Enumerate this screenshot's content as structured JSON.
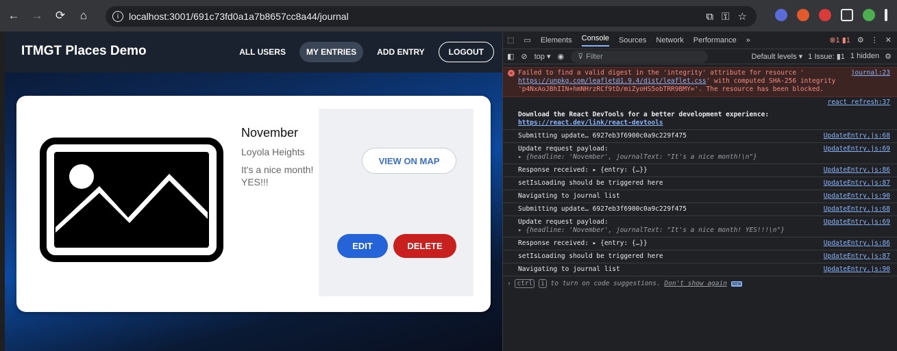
{
  "browser": {
    "url": "localhost:3001/691c73fd0a1a7b8657cc8a44/journal"
  },
  "app": {
    "brand": "ITMGT Places Demo",
    "nav": {
      "all_users": "ALL USERS",
      "my_entries": "MY ENTRIES",
      "add_entry": "ADD ENTRY",
      "logout": "LOGOUT"
    },
    "entry": {
      "title": "November",
      "address": "Loyola Heights",
      "text": "It's a nice month! YES!!!",
      "view_on_map": "VIEW ON MAP",
      "edit": "EDIT",
      "delete": "DELETE"
    }
  },
  "devtools": {
    "tabs": [
      "Elements",
      "Console",
      "Sources",
      "Network",
      "Performance",
      "»"
    ],
    "active_tab": "Console",
    "context": "top ▾",
    "filter_placeholder": "Filter",
    "levels": "Default levels ▾",
    "issues": "1 Issue: ▮1",
    "hidden": "1 hidden",
    "error": {
      "text1": "Failed to find a valid digest in the 'integrity' attribute for resource '",
      "link": "https://unpkg.com/leaflet@1.9.4/dist/leaflet.css",
      "text2": "' with computed SHA-256 integrity 'p4NxAoJBhIIN+hmNHrzRCf9tD/miZyoHS5obTRR9BMY='. The resource has been blocked.",
      "source": "journal:23"
    },
    "logs": [
      {
        "text": "Download the React DevTools for a better development experience:",
        "link": "https://react.dev/link/react-devtools",
        "source": "react refresh:37"
      },
      {
        "text": "Submitting update… 6927eb3f6900c0a9c229f475",
        "source": "UpdateEntry.js:68"
      },
      {
        "text": "Update request payload:",
        "sub": "▸ {headline: 'November', journalText: \"It's a nice month!\\n\"}",
        "source": "UpdateEntry.js:69"
      },
      {
        "text": "Response received:  ▸ {entry: {…}}",
        "source": "UpdateEntry.js:86"
      },
      {
        "text": "setIsLoading should be triggered here",
        "source": "UpdateEntry.js:87"
      },
      {
        "text": "Navigating to journal list",
        "source": "UpdateEntry.js:90"
      },
      {
        "text": "Submitting update… 6927eb3f6900c0a9c229f475",
        "source": "UpdateEntry.js:68"
      },
      {
        "text": "Update request payload:",
        "sub": "▸ {headline: 'November', journalText: \"It's a nice month! YES!!!\\n\"}",
        "source": "UpdateEntry.js:69"
      },
      {
        "text": "Response received:  ▸ {entry: {…}}",
        "source": "UpdateEntry.js:86"
      },
      {
        "text": "setIsLoading should be triggered here",
        "source": "UpdateEntry.js:87"
      },
      {
        "text": "Navigating to journal list",
        "source": "UpdateEntry.js:90"
      }
    ],
    "prompt": {
      "key1": "ctrl",
      "key2": "i",
      "text": " to turn on code suggestions. ",
      "dismiss": "Don't show again",
      "badge": "NEW"
    }
  }
}
